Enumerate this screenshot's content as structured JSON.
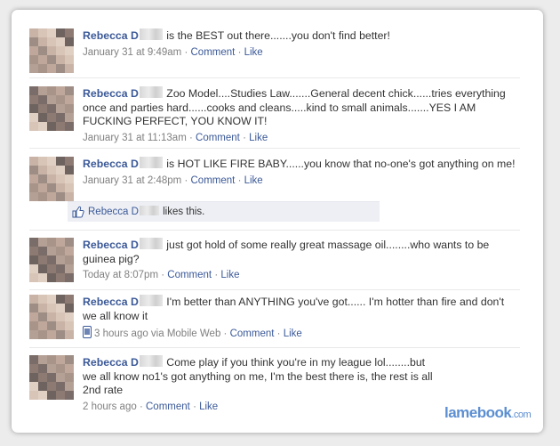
{
  "posts": [
    {
      "author": "Rebecca D",
      "text": " is the BEST out there.......you don't find better!",
      "time": "January 31 at 9:49am",
      "comment": "Comment",
      "like": "Like"
    },
    {
      "author": "Rebecca D",
      "text": " Zoo Model....Studies Law.......General decent chick......tries everything once and parties hard......cooks and cleans.....kind to small animals.......YES I AM FUCKING PERFECT, YOU KNOW IT!",
      "time": "January 31 at 11:13am",
      "comment": "Comment",
      "like": "Like"
    },
    {
      "author": "Rebecca D",
      "text": " is HOT LIKE FIRE BABY......you know that no-one's got anything on me!",
      "time": "January 31 at 2:48pm",
      "comment": "Comment",
      "like": "Like",
      "likes_box": {
        "icon": "thumbs-up-icon",
        "name": "Rebecca D",
        "text": " likes this."
      }
    },
    {
      "author": "Rebecca D",
      "text": " just got hold of some really great massage oil........who wants to be guinea pig?",
      "time": "Today at 8:07pm",
      "comment": "Comment",
      "like": "Like"
    },
    {
      "author": "Rebecca D",
      "text": " I'm better than ANYTHING you've got...... I'm hotter than fire and don't we all know it",
      "time": "3 hours ago via Mobile Web",
      "comment": "Comment",
      "like": "Like",
      "icon": "mobile-phone-icon"
    },
    {
      "author": "Rebecca D",
      "text": " Come play if you think you're in my league lol........but we all know no1's got anything on me, I'm the best there is, the rest is all 2nd rate",
      "time": "2 hours ago",
      "comment": "Comment",
      "like": "Like"
    }
  ],
  "watermark": {
    "brand": "lamebook",
    "domain": ".com"
  },
  "colors": {
    "link": "#3b5998",
    "meta": "#808080",
    "likes_bg": "#edeff4",
    "watermark": "#5c8fd2"
  }
}
